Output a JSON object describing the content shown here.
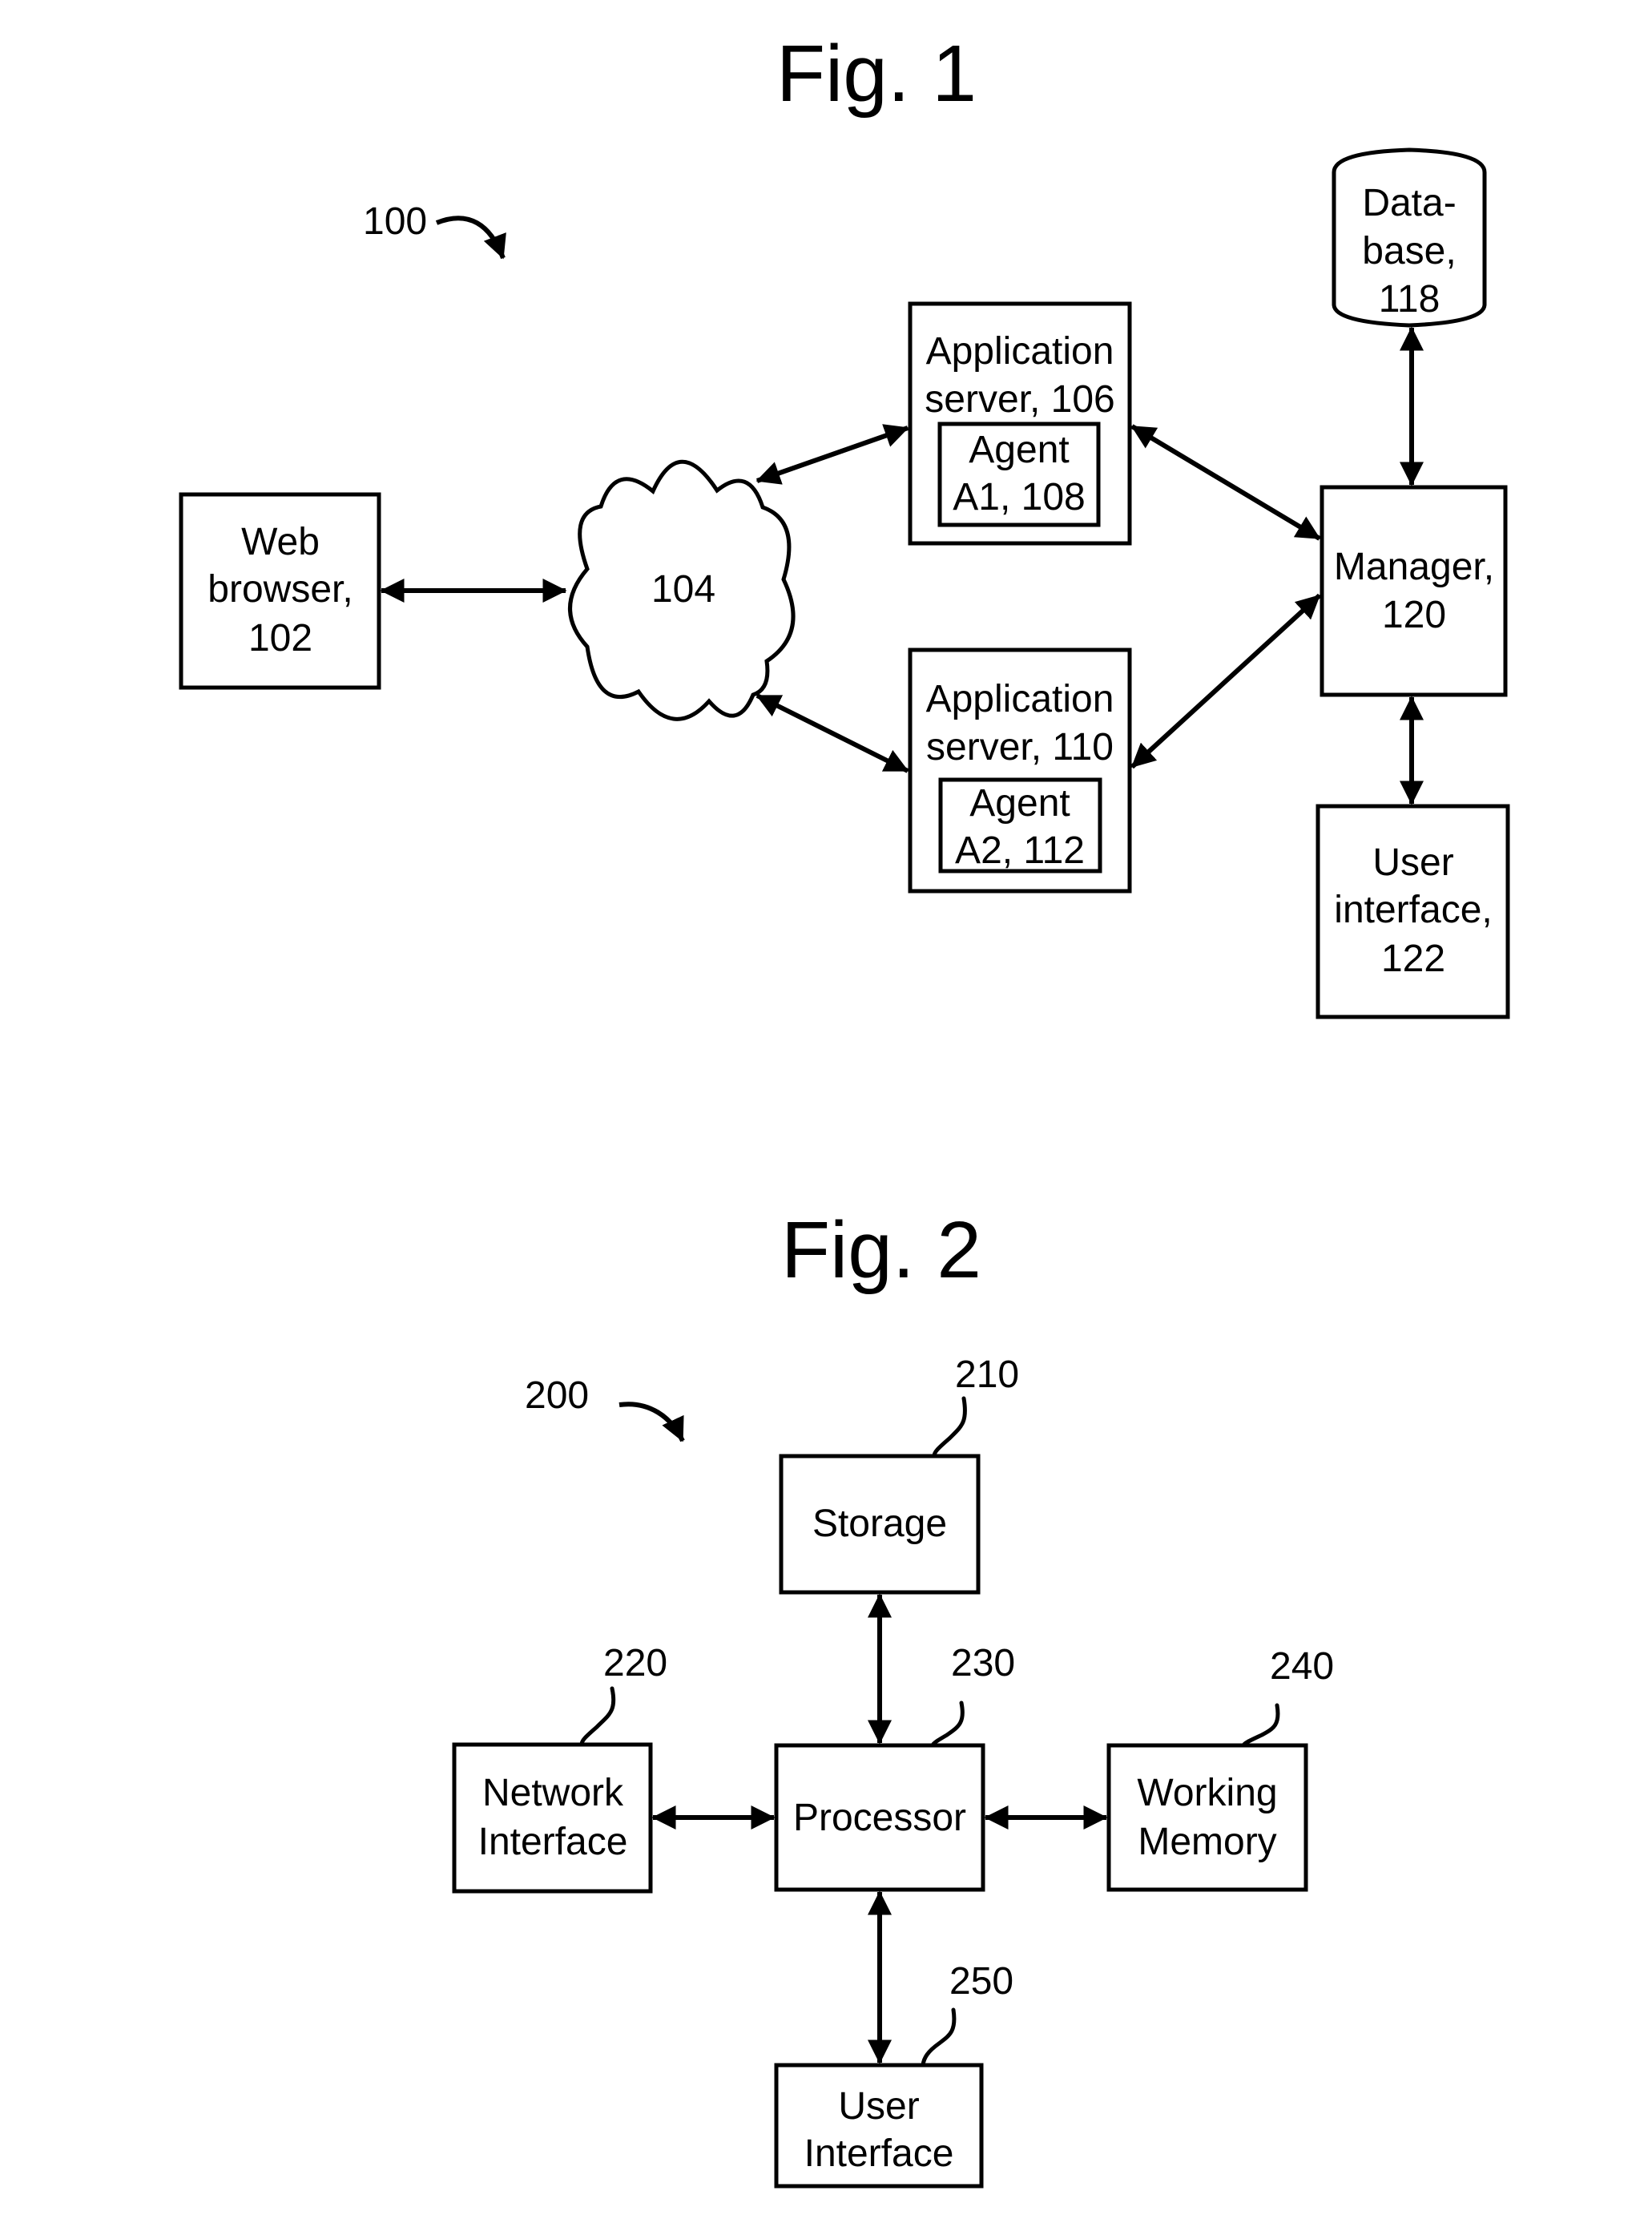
{
  "figure1": {
    "title": "Fig. 1",
    "ref_label": "100",
    "web_browser": {
      "lines": [
        "Web",
        "browser,",
        "102"
      ]
    },
    "network": {
      "label": "104"
    },
    "app_server_1": {
      "lines": [
        "Application",
        "server, 106"
      ],
      "agent_lines": [
        "Agent",
        "A1, 108"
      ]
    },
    "app_server_2": {
      "lines": [
        "Application",
        "server, 110"
      ],
      "agent_lines": [
        "Agent",
        "A2, 112"
      ]
    },
    "database": {
      "lines": [
        "Data-",
        "base,",
        "118"
      ]
    },
    "manager": {
      "lines": [
        "Manager,",
        "120"
      ]
    },
    "user_interface": {
      "lines": [
        "User",
        "interface,",
        "122"
      ]
    }
  },
  "figure2": {
    "title": "Fig. 2",
    "ref_label": "200",
    "storage": {
      "label": "Storage",
      "ref": "210"
    },
    "network_interface": {
      "lines": [
        "Network",
        "Interface"
      ],
      "ref": "220"
    },
    "processor": {
      "label": "Processor",
      "ref": "230"
    },
    "working_memory": {
      "lines": [
        "Working",
        "Memory"
      ],
      "ref": "240"
    },
    "user_interface": {
      "lines": [
        "User",
        "Interface"
      ],
      "ref": "250"
    }
  }
}
